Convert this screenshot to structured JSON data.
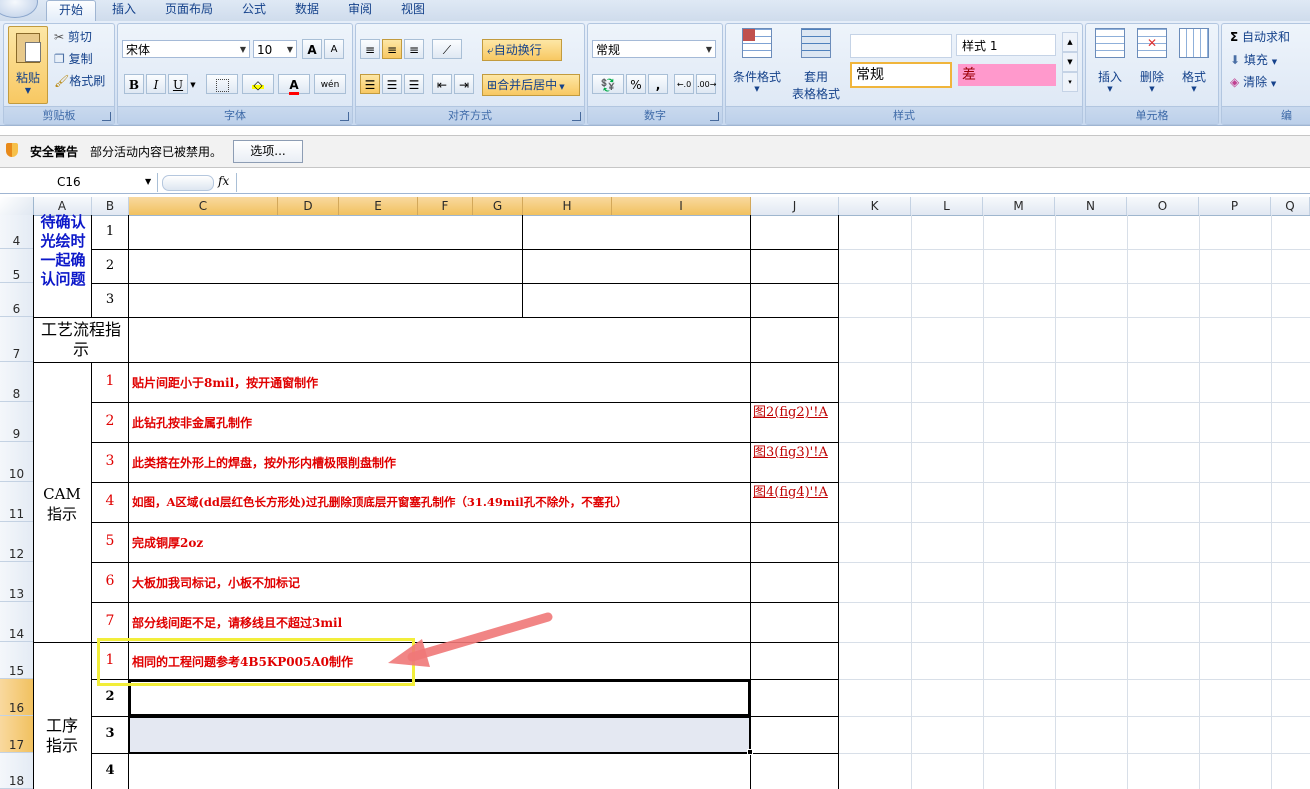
{
  "ribbon_tabs": [
    "开始",
    "插入",
    "页面布局",
    "公式",
    "数据",
    "审阅",
    "视图"
  ],
  "clipboard": {
    "paste": "粘贴",
    "cut": "剪切",
    "copy": "复制",
    "format_painter": "格式刷",
    "label": "剪贴板"
  },
  "font": {
    "name": "宋体",
    "size": "10",
    "bold": "B",
    "italic": "I",
    "underline": "U",
    "grow": "A",
    "shrink": "A",
    "font_color": "A",
    "phonetic": "wén",
    "label": "字体"
  },
  "alignment": {
    "wrap": "自动换行",
    "merge": "合并后居中",
    "label": "对齐方式"
  },
  "number": {
    "format": "常规",
    "percent": "%",
    "comma": ",",
    "label": "数字"
  },
  "styles": {
    "conditional": "条件格式",
    "table_format_1": "套用",
    "table_format_2": "表格格式",
    "style1": "样式 1",
    "normal": "常规",
    "bad": "差",
    "label": "样式",
    "bad_color": "#ff99cc"
  },
  "cells": {
    "insert": "插入",
    "delete": "删除",
    "format": "格式",
    "label": "单元格"
  },
  "editing": {
    "autosum": "自动求和",
    "fill": "填充",
    "clear": "清除",
    "label": "编"
  },
  "security": {
    "title": "安全警告",
    "message": "部分活动内容已被禁用。",
    "options": "选项..."
  },
  "formula_bar": {
    "name_box": "C16",
    "fx": "fx"
  },
  "columns": [
    "A",
    "B",
    "C",
    "D",
    "E",
    "F",
    "G",
    "H",
    "I",
    "J",
    "K",
    "L",
    "M",
    "N",
    "O",
    "P",
    "Q"
  ],
  "rows": [
    "4",
    "5",
    "6",
    "7",
    "8",
    "9",
    "10",
    "11",
    "12",
    "13",
    "14",
    "15",
    "16",
    "17",
    "18"
  ],
  "sheet": {
    "pending_label": "待确认光绘时一起确认问题",
    "pending_nums": [
      "1",
      "2",
      "3"
    ],
    "process_label": "工艺流程指示",
    "cam_label": "CAM指示",
    "cam_items": [
      {
        "n": "1",
        "text": "贴片间距小于8mil，按开通窗制作",
        "link": ""
      },
      {
        "n": "2",
        "text": "此钻孔按非金属孔制作",
        "link": "图2(fig2)'!A"
      },
      {
        "n": "3",
        "text": "此类搭在外形上的焊盘，按外形内槽极限削盘制作",
        "link": "图3(fig3)'!A"
      },
      {
        "n": "4",
        "text": "如图，A区域(dd层红色长方形处)过孔删除顶底层开窗塞孔制作（31.49mil孔不除外，不塞孔）",
        "link": "图4(fig4)'!A"
      },
      {
        "n": "5",
        "text": "完成铜厚2oz",
        "link": ""
      },
      {
        "n": "6",
        "text": "大板加我司标记，小板不加标记",
        "link": ""
      },
      {
        "n": "7",
        "text": "部分线间距不足，请移线且不超过3mil",
        "link": ""
      }
    ],
    "step_label": "工序指示",
    "step_items": [
      {
        "n": "1",
        "text": "相同的工程问题参考4B5KP005A0制作"
      },
      {
        "n": "2",
        "text": ""
      },
      {
        "n": "3",
        "text": ""
      },
      {
        "n": "4",
        "text": ""
      }
    ]
  }
}
